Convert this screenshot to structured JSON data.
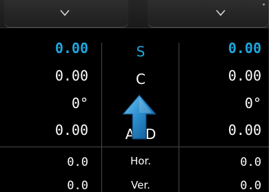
{
  "dropdowns": {
    "left": {
      "icon": "chevron-down-icon"
    },
    "right": {
      "icon": "chevron-down-icon"
    }
  },
  "rows": {
    "sphere": {
      "left": "0.00",
      "label": "S",
      "right": "0.00"
    },
    "cylinder": {
      "left": "0.00",
      "label": "C",
      "right": "0.00"
    },
    "axis": {
      "left": "0°",
      "label": "",
      "right": "0°"
    },
    "addition": {
      "left": "0.00",
      "label": "ADD",
      "right": "0.00"
    },
    "horizontal": {
      "left": "0.0",
      "label": "Hor.",
      "right": "0.0"
    },
    "vertical": {
      "left": "0.0",
      "label": "Ver.",
      "right": "0.0"
    }
  },
  "overlay": {
    "icon": "arrow-up-icon"
  },
  "colors": {
    "accent": "#1fa7e0",
    "background": "#000000",
    "text": "#ffffff",
    "divider": "#4a4a4a"
  }
}
